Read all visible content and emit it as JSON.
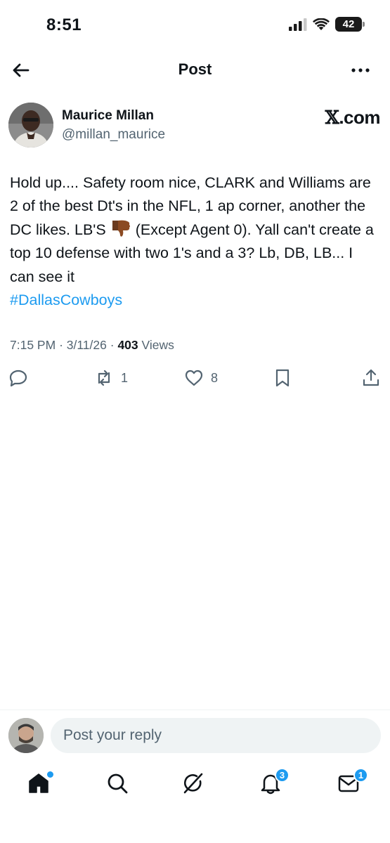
{
  "status_bar": {
    "time": "8:51",
    "battery": "42"
  },
  "header": {
    "title": "Post"
  },
  "author": {
    "name": "Maurice Millan",
    "handle": "@millan_maurice",
    "source_badge_x": "𝕏",
    "source_badge_suffix": ".com"
  },
  "post": {
    "text_part1": "Hold up.... Safety room nice, CLARK and Williams are 2 of the best Dt's in the NFL, 1 ap corner, another the DC likes. LB'S",
    "text_part2": " (Except Agent 0). Yall can't create a top 10 defense with two 1's and a 3? Lb, DB, LB... I can see it",
    "hashtag": "#DallasCowboys",
    "time": "7:15 PM",
    "separator": "·",
    "date": "3/11/26",
    "views_count": "403",
    "views_label": "Views"
  },
  "actions": {
    "reply_icon": "reply-icon",
    "repost_count": "1",
    "like_count": "8",
    "bookmark_icon": "bookmark-icon",
    "share_icon": "share-icon"
  },
  "reply": {
    "placeholder": "Post your reply"
  },
  "bottom_nav": {
    "notifications_badge": "3",
    "messages_badge": "1"
  },
  "colors": {
    "accent": "#1d9bf0",
    "text": "#0f1419",
    "secondary": "#536471"
  }
}
